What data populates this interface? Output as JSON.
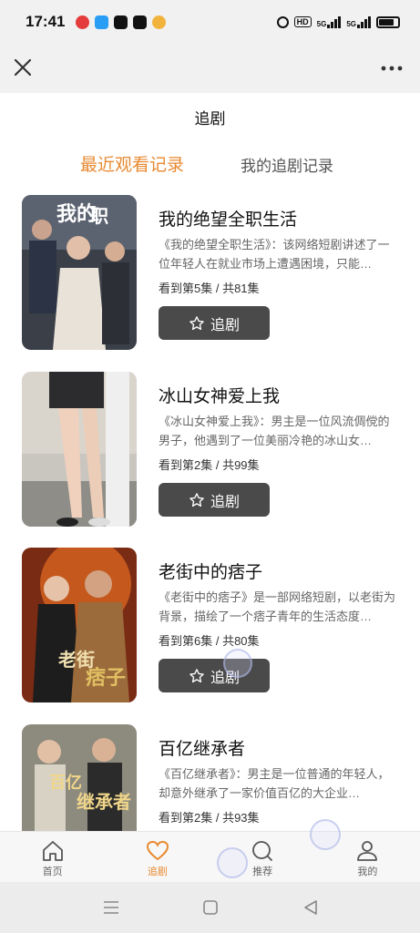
{
  "status": {
    "time": "17:41",
    "signal1": "5G",
    "signal2": "5G"
  },
  "page": {
    "title": "追剧"
  },
  "tabs": {
    "recent": "最近观看记录",
    "mine": "我的追剧记录"
  },
  "items": [
    {
      "title": "我的绝望全职生活",
      "desc": "《我的绝望全职生活》：该网络短剧讲述了一位年轻人在就业市场上遭遇困境，只能…",
      "progress": "看到第5集 / 共81集",
      "button": "追剧",
      "poster_text": "我的绝望全职生活"
    },
    {
      "title": "冰山女神爱上我",
      "desc": "《冰山女神爱上我》：男主是一位风流倜傥的男子，他遇到了一位美丽冷艳的冰山女…",
      "progress": "看到第2集 / 共99集",
      "button": "追剧",
      "poster_text": ""
    },
    {
      "title": "老街中的痞子",
      "desc": "《老街中的痞子》是一部网络短剧，以老街为背景，描绘了一个痞子青年的生活态度…",
      "progress": "看到第6集 / 共80集",
      "button": "追剧",
      "poster_text": "老街中的痞子"
    },
    {
      "title": "百亿继承者",
      "desc": "《百亿继承者》：男主是一位普通的年轻人，却意外继承了一家价值百亿的大企业…",
      "progress": "看到第2集 / 共93集",
      "button": "追剧",
      "poster_text": "百亿继承者"
    }
  ],
  "tabbar": [
    {
      "label": "首页",
      "icon": "home-icon"
    },
    {
      "label": "追剧",
      "icon": "heart-icon",
      "active": true
    },
    {
      "label": "推荐",
      "icon": "search-icon"
    },
    {
      "label": "我的",
      "icon": "user-icon"
    }
  ],
  "colors": {
    "accent": "#e88a32",
    "button": "#4a4a4a"
  }
}
